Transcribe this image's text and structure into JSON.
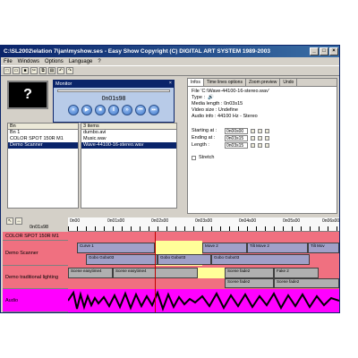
{
  "titlebar": {
    "text": "C:\\SL2002\\elation 7\\jan\\myshow.ses - Easy Show      Copyright (C) DIGITAL ART SYSTEM 1989-2003",
    "minimize": "_",
    "maximize": "□",
    "close": "×"
  },
  "menu": [
    "File",
    "Windows",
    "Options",
    "Language",
    "?"
  ],
  "preview": {
    "symbol": "?"
  },
  "monitor": {
    "title": "Monitor",
    "close": "×",
    "time": "0n01s98"
  },
  "fixtures": {
    "header": "Bn",
    "items": [
      "Bn 1",
      "COLOR SPOT 150R M1",
      "Demo Scanner"
    ]
  },
  "media": {
    "header": "3 items",
    "items": [
      "dumbo.avi",
      "Music.wav",
      "Wave-44100-16-stereo.wav"
    ]
  },
  "tabs": [
    "Infos",
    "Time lines options",
    "Zoom preview",
    "Undo"
  ],
  "info": {
    "file": "File  'C:\\Wave-44100-16-stereo.wav'",
    "type": "Type  :",
    "media_length": "Media length : 0n03s15",
    "video_size": "Video size : Undefine",
    "audio_info": "Audio info : 44100 Hz - Stereo",
    "starting_label": "Starting at :",
    "starting_value": "0n00s00",
    "ending_label": "Ending at :",
    "ending_value": "0n03s15",
    "length_label": "Length :",
    "length_value": "0n03s15",
    "stretch": "Stretch"
  },
  "ruler": {
    "current": "0n01s98",
    "ticks": [
      "0n00",
      "0n01s00",
      "0n02s00",
      "0n03s00",
      "0n04s00",
      "0n05s00",
      "0n06s00"
    ]
  },
  "tracks": [
    {
      "name": "COLOR SPOT 150R M1",
      "color": "#f07080",
      "blocks": []
    },
    {
      "name": "Demo Scanner",
      "color": "#f07080",
      "blocks": [
        {
          "label": "Curve 1",
          "step": "1",
          "color": "#a0a0c8"
        },
        {
          "label": "Move 2",
          "step": "2",
          "color": "#a0a0c8"
        },
        {
          "label": "Tilt Move 2",
          "step": "2",
          "color": "#a0a0c8"
        },
        {
          "label": "Tilt Mov",
          "step": "2",
          "color": "#a0a0c8"
        },
        {
          "label": "Gobo Gobo03",
          "step": "1",
          "color": "#a0a0c8"
        },
        {
          "label": "Gobo Gobo03",
          "step": "1",
          "color": "#a0a0c8"
        },
        {
          "label": "Gobo Gobo03",
          "step": "2",
          "color": "#a0a0c8"
        }
      ]
    },
    {
      "name": "Demo traditional lighting",
      "color": "#f07080",
      "blocks": [
        {
          "label": "Scene easytime4",
          "step": "1",
          "color": "#b0b0b0"
        },
        {
          "label": "Scene easytime4",
          "step": "1",
          "color": "#b0b0b0"
        },
        {
          "label": "Scene fade2",
          "step": "2",
          "color": "#b0b0b0"
        },
        {
          "label": "Fake 2",
          "step": "2",
          "color": "#b0b0b0"
        },
        {
          "label": "Scene fade2",
          "step": "1",
          "color": "#b0b0b0"
        },
        {
          "label": "Scene fade2",
          "step": "1",
          "color": "#b0b0b0"
        }
      ]
    },
    {
      "name": "Audio",
      "color": "#ff00ff",
      "blocks": []
    }
  ],
  "colors": {
    "selection": "#ffff99",
    "track_bg": "#f07080",
    "audio_bg": "#ff00ff"
  }
}
